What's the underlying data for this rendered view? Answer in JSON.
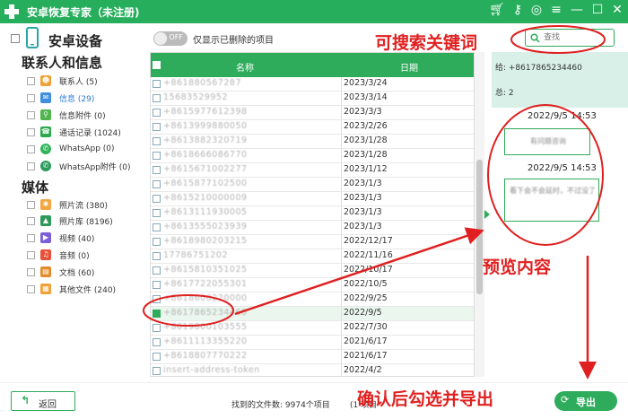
{
  "window": {
    "title": "安卓恢复专家（未注册)"
  },
  "sidebar": {
    "device_label": "安卓设备",
    "section_contacts": "联系人和信息",
    "section_media": "媒体",
    "contacts_items": [
      {
        "label": "联系人 (5)",
        "icon": "contacts-icon",
        "color": "#f0a23a"
      },
      {
        "label": "信息 (29)",
        "icon": "messages-icon",
        "color": "#3f8ee0"
      },
      {
        "label": "信息附件 (0)",
        "icon": "attachment-icon",
        "color": "#4fb54c"
      },
      {
        "label": "通话记录 (1024)",
        "icon": "call-log-icon",
        "color": "#2aa84a"
      },
      {
        "label": "WhatsApp (0)",
        "icon": "whatsapp-icon",
        "color": "#2fb45a"
      },
      {
        "label": "WhatsApp附件 (0)",
        "icon": "whatsapp-attachment-icon",
        "color": "#2a9a5a"
      }
    ],
    "media_items": [
      {
        "label": "照片流 (380)",
        "icon": "photo-stream-icon",
        "color": "#f2a640"
      },
      {
        "label": "照片库 (8196)",
        "icon": "photo-library-icon",
        "color": "#2e9a5a"
      },
      {
        "label": "视频 (40)",
        "icon": "video-icon",
        "color": "#7b5fd6"
      },
      {
        "label": "音频 (0)",
        "icon": "audio-icon",
        "color": "#e6533a"
      },
      {
        "label": "文档 (60)",
        "icon": "document-icon",
        "color": "#e58a2a"
      },
      {
        "label": "其他文件 (240)",
        "icon": "other-files-icon",
        "color": "#f0a23a"
      }
    ]
  },
  "toolbar": {
    "toggle_state": "OFF",
    "toggle_label": "仅显示已删除的项目",
    "search_placeholder": "查找"
  },
  "table": {
    "header_name": "名称",
    "header_date": "日期",
    "rows": [
      {
        "name": "+861880567287",
        "date": "2023/3/24"
      },
      {
        "name": "15683529952",
        "date": "2023/3/14"
      },
      {
        "name": "+8615977612398",
        "date": "2023/3/3"
      },
      {
        "name": "+8613999880050",
        "date": "2023/2/26"
      },
      {
        "name": "+8613882320719",
        "date": "2023/1/28"
      },
      {
        "name": "+8618666086770",
        "date": "2023/1/28"
      },
      {
        "name": "+8615671002277",
        "date": "2023/1/12"
      },
      {
        "name": "+8615877102500",
        "date": "2023/1/3"
      },
      {
        "name": "+8615210000009",
        "date": "2023/1/3"
      },
      {
        "name": "+8613111930005",
        "date": "2023/1/3"
      },
      {
        "name": "+8613555023939",
        "date": "2023/1/3"
      },
      {
        "name": "+8618980203215",
        "date": "2022/12/17"
      },
      {
        "name": "17786751202",
        "date": "2022/11/16"
      },
      {
        "name": "+8615810351025",
        "date": "2022/10/17"
      },
      {
        "name": "+8617722055301",
        "date": "2022/10/5"
      },
      {
        "name": "+8618600220000",
        "date": "2022/9/25"
      },
      {
        "name": "+8617865234460",
        "date": "2022/9/5"
      },
      {
        "name": "+8619800103555",
        "date": "2022/7/30"
      },
      {
        "name": "+8611113355220",
        "date": "2021/6/17"
      },
      {
        "name": "+8618807770222",
        "date": "2021/6/17"
      },
      {
        "name": "insert-address-token",
        "date": "2022/4/2"
      }
    ]
  },
  "preview": {
    "to_line": "给: +8617865234460",
    "total": "总: 2",
    "messages": [
      {
        "time": "2022/9/5 14:53",
        "text": "有问题咨询"
      },
      {
        "time": "2022/9/5 14:53",
        "text": "看下会不会延时，不过没了"
      }
    ]
  },
  "bottom": {
    "back_label": "返回",
    "status_text": "找到的文件数: 9974个项目",
    "status_selected": "(1 项目",
    "export_label": "导出"
  },
  "annotations": {
    "search_hint": "可搜索关键词",
    "preview_hint": "预览内容",
    "export_hint": "确认后勾选并导出"
  }
}
